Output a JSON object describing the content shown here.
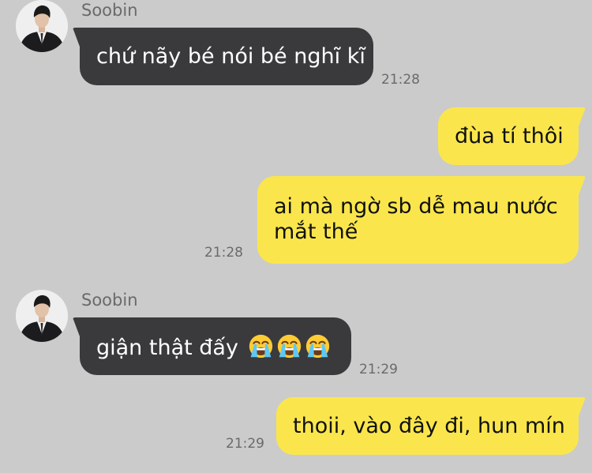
{
  "chat": {
    "messages": [
      {
        "direction": "incoming",
        "sender": "Soobin",
        "text": "chứ nãy bé nói bé nghĩ kĩ",
        "time": "21:28"
      },
      {
        "direction": "outgoing",
        "text": "đùa tí thôi"
      },
      {
        "direction": "outgoing",
        "text": "ai mà ngờ sb dễ mau nước mắt thế",
        "time": "21:28"
      },
      {
        "direction": "incoming",
        "sender": "Soobin",
        "text": "giận thật đấy",
        "emojis": [
          "loudly-crying-face",
          "loudly-crying-face",
          "loudly-crying-face"
        ],
        "time": "21:29"
      },
      {
        "direction": "outgoing",
        "text": "thoii, vào đây đi, hun mín",
        "time": "21:29"
      }
    ]
  },
  "colors": {
    "background": "#cbcbcb",
    "incoming_bubble": "#3a3a3c",
    "outgoing_bubble": "#fae64c",
    "timestamp": "#6a6a6a"
  }
}
